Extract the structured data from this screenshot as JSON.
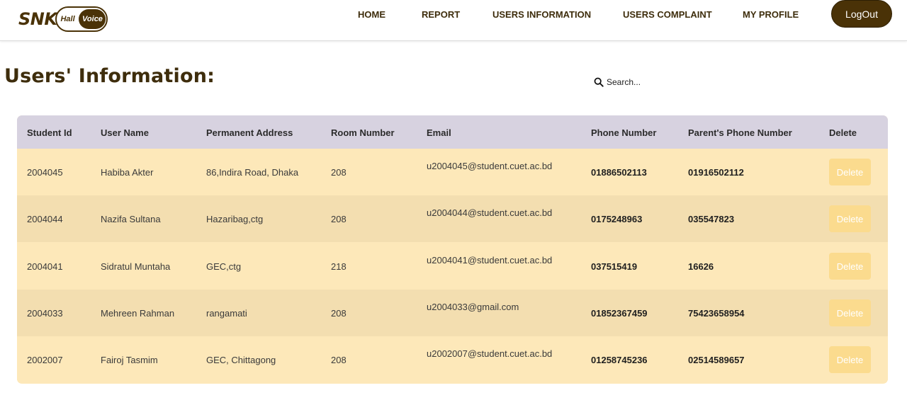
{
  "logo": {
    "main": "SNK",
    "hall": "Hall",
    "voice": "Voice"
  },
  "nav": {
    "items": [
      "HOME",
      "REPORT",
      "USERS INFORMATION",
      "USERS COMPLAINT",
      "MY PROFILE"
    ],
    "logout_label": "LogOut"
  },
  "page": {
    "title": "Users' Information:"
  },
  "search": {
    "placeholder": "Search..."
  },
  "table": {
    "headers": [
      "Student Id",
      "User Name",
      "Permanent Address",
      "Room Number",
      "Email",
      "Phone Number",
      "Parent's Phone Number",
      "Delete"
    ],
    "delete_label": "Delete",
    "rows": [
      {
        "id": "2004045",
        "name": "Habiba Akter",
        "address": "86,Indira Road, Dhaka",
        "room": "208",
        "email": "u2004045@student.cuet.ac.bd",
        "phone": "01886502113",
        "parent_phone": "01916502112"
      },
      {
        "id": "2004044",
        "name": "Nazifa Sultana",
        "address": "Hazaribag,ctg",
        "room": "208",
        "email": "u2004044@student.cuet.ac.bd",
        "phone": "0175248963",
        "parent_phone": "035547823"
      },
      {
        "id": "2004041",
        "name": "Sidratul Muntaha",
        "address": "GEC,ctg",
        "room": "218",
        "email": "u2004041@student.cuet.ac.bd",
        "phone": "037515419",
        "parent_phone": "16626"
      },
      {
        "id": "2004033",
        "name": "Mehreen Rahman",
        "address": "rangamati",
        "room": "208",
        "email": "u2004033@gmail.com",
        "phone": "01852367459",
        "parent_phone": "75423658954"
      },
      {
        "id": "2002007",
        "name": "Fairoj Tasmim",
        "address": "GEC, Chittagong",
        "room": "208",
        "email": "u2002007@student.cuet.ac.bd",
        "phone": "01258745236",
        "parent_phone": "02514589657"
      }
    ]
  },
  "colors": {
    "brand": "#4a3207",
    "header_bg": "#d7d2e0",
    "row_light": "#fde8b9",
    "row_dark": "#f3deb0",
    "delete_bg": "#fbdb8e"
  }
}
